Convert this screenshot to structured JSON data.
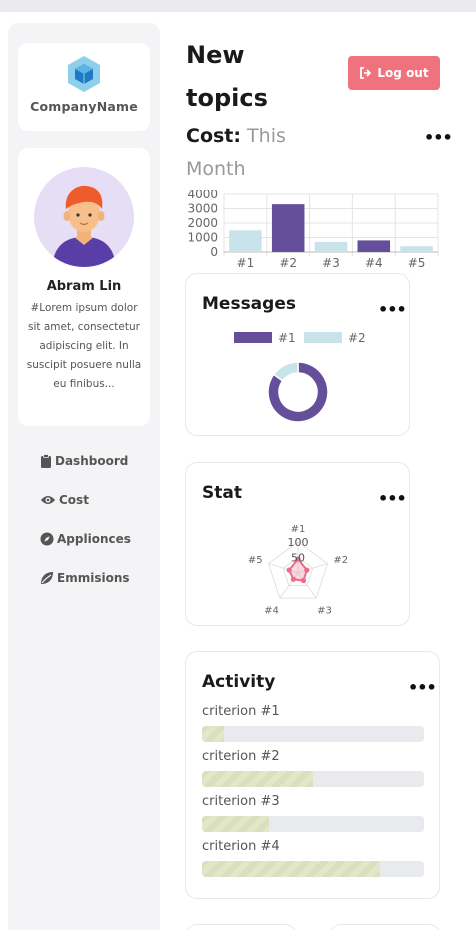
{
  "brand": {
    "company_name": "CompanyName",
    "logo_icon": "cube-icon"
  },
  "profile": {
    "name": "Abram Lin",
    "bio": "#Lorem ipsum dolor sit amet, consectetur adipiscing elit. In suscipit posuere nulla eu finibus..."
  },
  "nav": [
    {
      "label": "Dashboord",
      "icon": "clipboard-icon"
    },
    {
      "label": "Cost",
      "icon": "eye-icon"
    },
    {
      "label": "Applionces",
      "icon": "compass-icon"
    },
    {
      "label": "Emmisions",
      "icon": "leaf-icon"
    }
  ],
  "header": {
    "title": "New topics",
    "logout_label": "Log out",
    "logout_color": "#f0727e"
  },
  "cost": {
    "label": "Cost:",
    "period": "This Month",
    "more": "•••",
    "chart_data": {
      "type": "bar",
      "categories": [
        "#1",
        "#2",
        "#3",
        "#4",
        "#5"
      ],
      "values": [
        1500,
        3300,
        700,
        800,
        400
      ],
      "colors": [
        "#c9e3ea",
        "#654f9b",
        "#c9e3ea",
        "#654f9b",
        "#c9e3ea"
      ],
      "yticks": [
        0,
        1000,
        2000,
        3000,
        4000
      ],
      "ylim": [
        0,
        4000
      ]
    }
  },
  "messages": {
    "title": "Messages",
    "more": "•••",
    "chart_data": {
      "type": "pie",
      "labels": [
        "#1",
        "#2"
      ],
      "values": [
        85,
        15
      ],
      "colors": [
        "#654f9b",
        "#c9e3ea"
      ],
      "legend": "top"
    }
  },
  "stat": {
    "title": "Stat",
    "more": "•••",
    "chart_data": {
      "type": "radar",
      "labels": [
        "#1",
        "#2",
        "#3",
        "#4",
        "#5"
      ],
      "values": [
        45,
        30,
        30,
        25,
        30
      ],
      "rticks": [
        50,
        100
      ],
      "max": 100,
      "color": "#ec6a8a"
    }
  },
  "activity": {
    "title": "Activity",
    "more": "•••",
    "criteria": [
      {
        "label": "criterion #1",
        "progress": 0.1
      },
      {
        "label": "criterion #2",
        "progress": 0.5
      },
      {
        "label": "criterion #3",
        "progress": 0.3
      },
      {
        "label": "criterion #4",
        "progress": 0.8
      }
    ]
  }
}
